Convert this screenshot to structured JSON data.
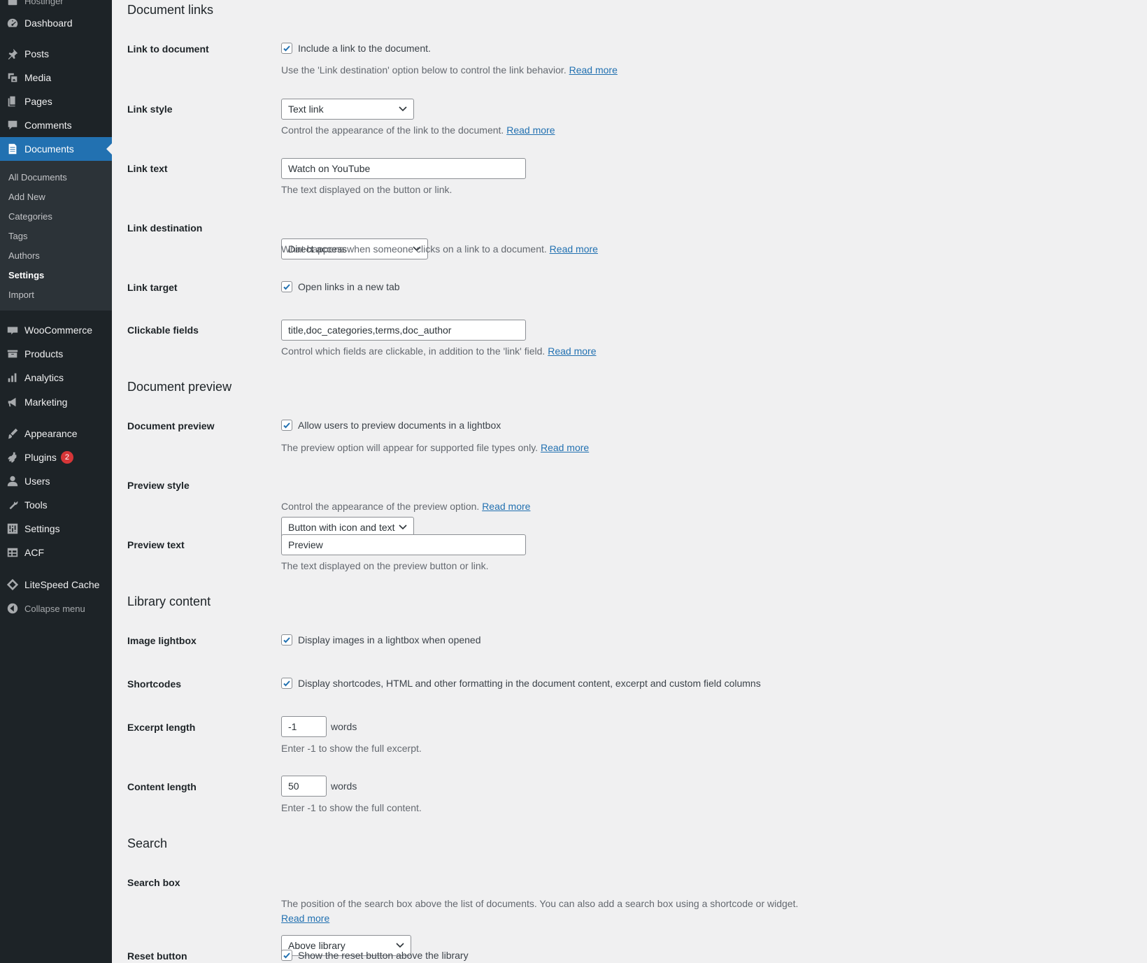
{
  "sidebar": {
    "top_partial": "Hostinger",
    "items": [
      {
        "label": "Dashboard",
        "icon": "dashboard-icon"
      },
      {
        "label": "Posts",
        "icon": "pin-icon"
      },
      {
        "label": "Media",
        "icon": "media-icon"
      },
      {
        "label": "Pages",
        "icon": "pages-icon"
      },
      {
        "label": "Comments",
        "icon": "comment-icon"
      },
      {
        "label": "Documents",
        "icon": "document-icon"
      },
      {
        "label": "WooCommerce",
        "icon": "woo-icon"
      },
      {
        "label": "Products",
        "icon": "archive-icon"
      },
      {
        "label": "Analytics",
        "icon": "bar-chart-icon"
      },
      {
        "label": "Marketing",
        "icon": "megaphone-icon"
      },
      {
        "label": "Appearance",
        "icon": "brush-icon"
      },
      {
        "label": "Plugins",
        "icon": "plugin-icon",
        "badge": "2"
      },
      {
        "label": "Users",
        "icon": "user-icon"
      },
      {
        "label": "Tools",
        "icon": "wrench-icon"
      },
      {
        "label": "Settings",
        "icon": "sliders-icon"
      },
      {
        "label": "ACF",
        "icon": "table-icon"
      },
      {
        "label": "LiteSpeed Cache",
        "icon": "diamond-icon"
      },
      {
        "label": "Collapse menu",
        "icon": "collapse-icon"
      }
    ],
    "submenu": [
      "All Documents",
      "Add New",
      "Categories",
      "Tags",
      "Authors",
      "Settings",
      "Import"
    ]
  },
  "sections": {
    "links": {
      "title": "Document links",
      "link_to_document": {
        "label": "Link to document",
        "check": "Include a link to the document.",
        "desc": "Use the 'Link destination' option below to control the link behavior.",
        "more": "Read more"
      },
      "link_style": {
        "label": "Link style",
        "value": "Text link",
        "desc": "Control the appearance of the link to the document.",
        "more": "Read more"
      },
      "link_text": {
        "label": "Link text",
        "value": "Watch on YouTube",
        "desc": "The text displayed on the button or link."
      },
      "link_destination": {
        "label": "Link destination",
        "value": "Direct access",
        "desc": "What happens when someone clicks on a link to a document.",
        "more": "Read more"
      },
      "link_target": {
        "label": "Link target",
        "check": "Open links in a new tab"
      },
      "clickable_fields": {
        "label": "Clickable fields",
        "value": "title,doc_categories,terms,doc_author",
        "desc": "Control which fields are clickable, in addition to the 'link' field.",
        "more": "Read more"
      }
    },
    "preview": {
      "title": "Document preview",
      "document_preview": {
        "label": "Document preview",
        "check": "Allow users to preview documents in a lightbox",
        "desc": "The preview option will appear for supported file types only.",
        "more": "Read more"
      },
      "preview_style": {
        "label": "Preview style",
        "value": "Button with icon and text",
        "desc": "Control the appearance of the preview option.",
        "more": "Read more"
      },
      "preview_text": {
        "label": "Preview text",
        "value": "Preview",
        "desc": "The text displayed on the preview button or link."
      }
    },
    "library": {
      "title": "Library content",
      "image_lightbox": {
        "label": "Image lightbox",
        "check": "Display images in a lightbox when opened"
      },
      "shortcodes": {
        "label": "Shortcodes",
        "check": "Display shortcodes, HTML and other formatting in the document content, excerpt and custom field columns"
      },
      "excerpt_length": {
        "label": "Excerpt length",
        "value": "-1",
        "unit": "words",
        "desc": "Enter -1 to show the full excerpt."
      },
      "content_length": {
        "label": "Content length",
        "value": "50",
        "unit": "words",
        "desc": "Enter -1 to show the full content."
      }
    },
    "search": {
      "title": "Search",
      "search_box": {
        "label": "Search box",
        "value": "Above library",
        "desc": "The position of the search box above the list of documents. You can also add a search box using a shortcode or widget.",
        "more": "Read more"
      },
      "reset_button": {
        "label": "Reset button",
        "check": "Show the reset button above the library"
      }
    }
  }
}
